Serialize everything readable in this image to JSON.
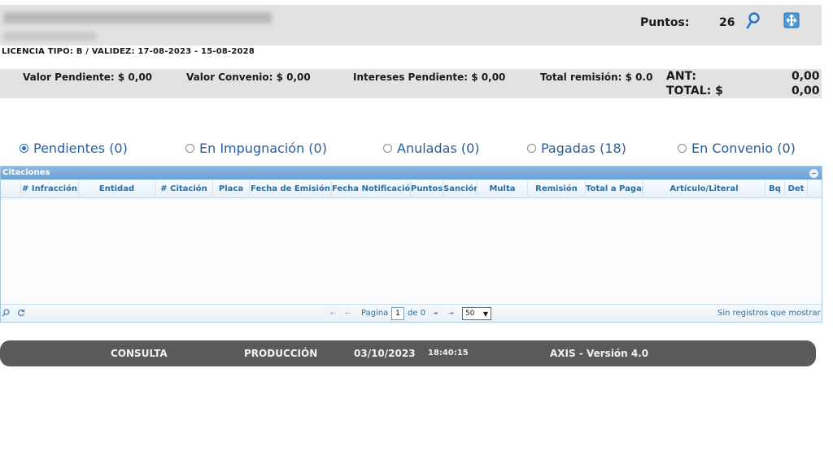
{
  "header": {
    "points_label": "Puntos:",
    "points_value": "26",
    "license": "LICENCIA TIPO: B   / VALIDEZ: 17-08-2023 - 15-08-2028"
  },
  "summary": {
    "valor_pendiente": "Valor Pendiente: $  0,00",
    "valor_convenio": "Valor Convenio: $  0,00",
    "intereses_pendiente": "Intereses Pendiente: $  0,00",
    "total_remision": "Total remisión: $ 0.0",
    "ant_label": "ANT:",
    "ant_value": "0,00",
    "total_label": "TOTAL: $",
    "total_value": "0,00"
  },
  "filters": [
    {
      "label": "Pendientes (0)",
      "checked": true
    },
    {
      "label": "En Impugnación (0)",
      "checked": false
    },
    {
      "label": "Anuladas (0)",
      "checked": false
    },
    {
      "label": "Pagadas (18)",
      "checked": false
    },
    {
      "label": "En Convenio (0)",
      "checked": false
    }
  ],
  "grid": {
    "title": "Citaciones",
    "columns": [
      "# Infracción",
      "Entidad",
      "# Citación",
      "Placa",
      "Fecha de Emisión",
      "Fecha Notificación",
      "Puntos",
      "Sanción",
      "Multa",
      "Remisión",
      "Total a Pagar",
      "Artículo/Literal",
      "Bq",
      "Det"
    ],
    "pager": {
      "page_label": "Pagina",
      "page_value": "1",
      "of_label": "de 0",
      "page_size": "50",
      "empty_message": "Sin registros que mostrar"
    }
  },
  "footer": {
    "mode": "CONSULTA",
    "env": "PRODUCCIÓN",
    "date": "03/10/2023",
    "time": "18:40:15",
    "version": "AXIS - Versión 4.0"
  },
  "colors": {
    "accent": "#2a6fb3",
    "grid_header": "#6aa2d4",
    "footer_bg": "#5a5a5a"
  }
}
